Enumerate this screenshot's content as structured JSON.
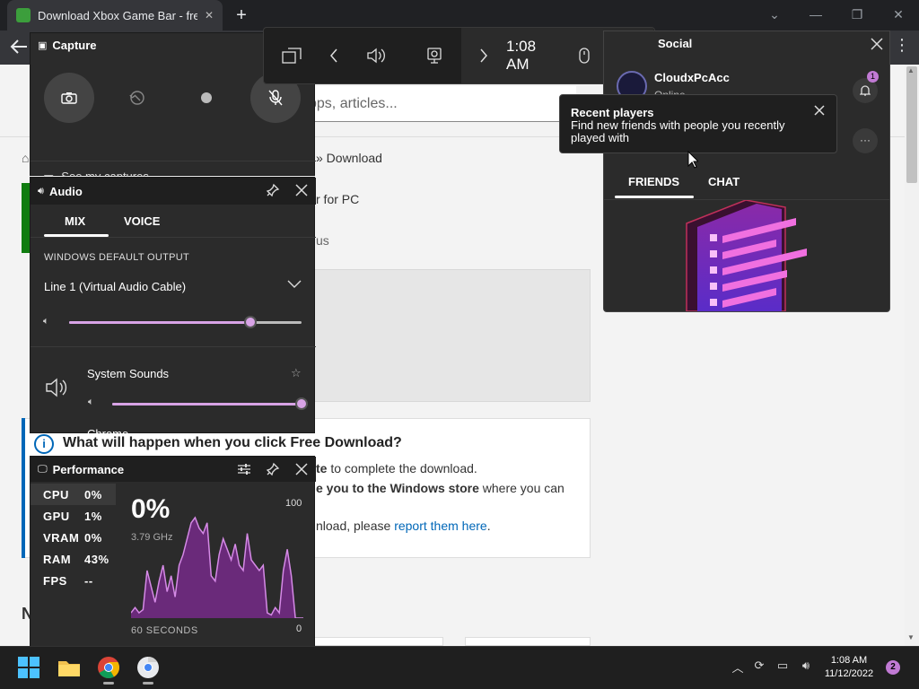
{
  "browser": {
    "tab_title": "Download Xbox Game Bar - free",
    "tab_close": "✕",
    "new_tab": "+",
    "search_placeholder": "pps, articles...",
    "breadcrumb_1": "» Download",
    "breadcrumb_2": "r for PC",
    "breadcrumb_3": "us",
    "info_title": "What will happen when you click Free Download?",
    "info_line1_bold": "te",
    "info_line1_rest": " to complete the download.",
    "info_line2_bold": "e you to the Windows store",
    "info_line2_rest": " where you can",
    "info_line3_prefix": "nload, please ",
    "info_line3_link": "report them here",
    "info_line3_suffix": ".",
    "footer_letter": "N"
  },
  "capture": {
    "title": "Capture",
    "see_captures": "See my captures"
  },
  "audio": {
    "title": "Audio",
    "tab_mix": "MIX",
    "tab_voice": "VOICE",
    "section": "WINDOWS DEFAULT OUTPUT",
    "device": "Line 1 (Virtual Audio Cable)",
    "master_level": 0.78,
    "app1_name": "System Sounds",
    "app1_level": 1.0,
    "app2_name": "Chrome"
  },
  "performance": {
    "title": "Performance",
    "rows": [
      {
        "label": "CPU",
        "value": "0%"
      },
      {
        "label": "GPU",
        "value": "1%"
      },
      {
        "label": "VRAM",
        "value": "0%"
      },
      {
        "label": "RAM",
        "value": "43%"
      },
      {
        "label": "FPS",
        "value": "--"
      }
    ],
    "big_value": "0%",
    "sub_value": "3.79 GHz",
    "max_label": "100",
    "min_label": "0",
    "time_label": "60 SECONDS",
    "graph": [
      5,
      10,
      5,
      8,
      45,
      30,
      15,
      35,
      50,
      25,
      40,
      20,
      50,
      60,
      75,
      90,
      95,
      85,
      80,
      90,
      40,
      35,
      60,
      75,
      65,
      55,
      70,
      50,
      45,
      80,
      55,
      50,
      45,
      50,
      5,
      3,
      10,
      5,
      45,
      65,
      40,
      0,
      0,
      0
    ]
  },
  "topbar": {
    "time": "1:08 AM"
  },
  "social": {
    "title": "Social",
    "username": "CloudxPcAcc",
    "status": "Online",
    "notif_count": "1",
    "tab_friends": "FRIENDS",
    "tab_chat": "CHAT",
    "tooltip_title": "Recent players",
    "tooltip_body": "Find new friends with people you recently played with",
    "more": "···"
  },
  "taskbar": {
    "time": "1:08 AM",
    "date": "11/12/2022",
    "notif_count": "2"
  },
  "colors": {
    "accent": "#c17ad4",
    "panel": "#2b2b2b",
    "page_bg": "#f3f3f3"
  },
  "icons": [
    "camera-icon",
    "replay-icon",
    "record-dot-icon",
    "mic-off-icon",
    "pin-icon",
    "close-icon",
    "speaker-icon",
    "chevron-down-icon",
    "star-icon",
    "settings-sliders-icon",
    "widget-menu-icon",
    "back-icon",
    "forward-icon",
    "gear-icon",
    "mouse-icon",
    "bell-icon",
    "windows-icon",
    "folder-icon",
    "chrome-icon"
  ]
}
